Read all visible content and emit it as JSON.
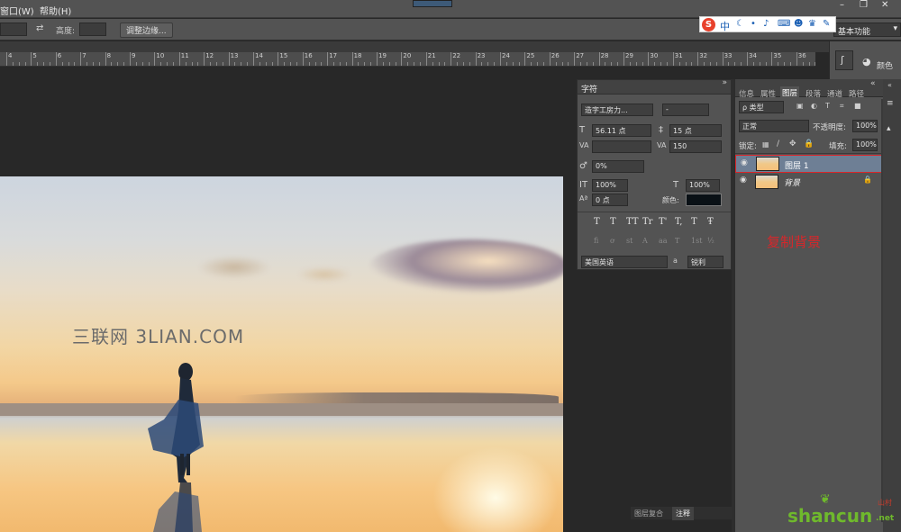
{
  "menubar": {
    "items": [
      "窗口(W)",
      "帮助(H)"
    ]
  },
  "optionsbar": {
    "height_label": "高度:",
    "refine_edge_button": "调整边缘...",
    "workspace": "基本功能"
  },
  "ruler": {
    "ticks": [
      "4",
      "5",
      "6",
      "7",
      "8",
      "9",
      "10",
      "11",
      "12",
      "13",
      "14",
      "15",
      "16",
      "17",
      "18",
      "19",
      "20",
      "21",
      "22",
      "23",
      "24",
      "25",
      "26",
      "27",
      "28",
      "29",
      "30",
      "31",
      "32",
      "33",
      "34",
      "35",
      "36"
    ]
  },
  "ime_bar": {
    "logo": "S",
    "mode": "中",
    "icons": [
      "moon-icon",
      "dot-icon",
      "mic-icon",
      "keyboard-icon",
      "user-icon",
      "shirt-icon",
      "wrench-icon"
    ]
  },
  "dock": {
    "color_label": "颜色"
  },
  "canvas": {
    "watermark": "三联网 3LIAN.COM"
  },
  "character_panel": {
    "title": "字符",
    "font_family": "造字工房力...",
    "font_style": "-",
    "font_size": "56.11 点",
    "leading": "15 点",
    "kerning": "",
    "tracking": "150",
    "tsume": "0%",
    "vertical_scale": "100%",
    "horizontal_scale": "100%",
    "baseline_shift": "0 点",
    "color_label": "颜色:",
    "text_color": "#0a1116",
    "style_buttons": [
      "T",
      "T",
      "TT",
      "Tr",
      "T'",
      "T,",
      "T",
      "Ŧ"
    ],
    "opentype_buttons": [
      "fi",
      "ơ",
      "st",
      "A",
      "aa",
      "T",
      "1st",
      "½"
    ],
    "language": "美国英语",
    "aa_label": "a",
    "antialias": "锐利"
  },
  "layers_panel": {
    "tabs": [
      "信息",
      "属性",
      "图层",
      "段落",
      "通道",
      "路径"
    ],
    "active_tab": "图层",
    "filter_kind": "ρ 类型",
    "blend_mode": "正常",
    "opacity_label": "不透明度:",
    "opacity": "100%",
    "lock_label": "锁定:",
    "fill_label": "填充:",
    "fill": "100%",
    "layers": [
      {
        "name": "图层 1",
        "selected": true
      },
      {
        "name": "背景",
        "selected": false
      }
    ]
  },
  "annotation": "复制背景",
  "bottom_tabs": [
    "图层复合",
    "注释"
  ],
  "logo": {
    "text": "shancun",
    "domain": ".net",
    "sub": "山村"
  },
  "colors": {
    "panel": "#535353",
    "selected_layer": "#6e7f95",
    "annotation_red": "#d8262a"
  }
}
